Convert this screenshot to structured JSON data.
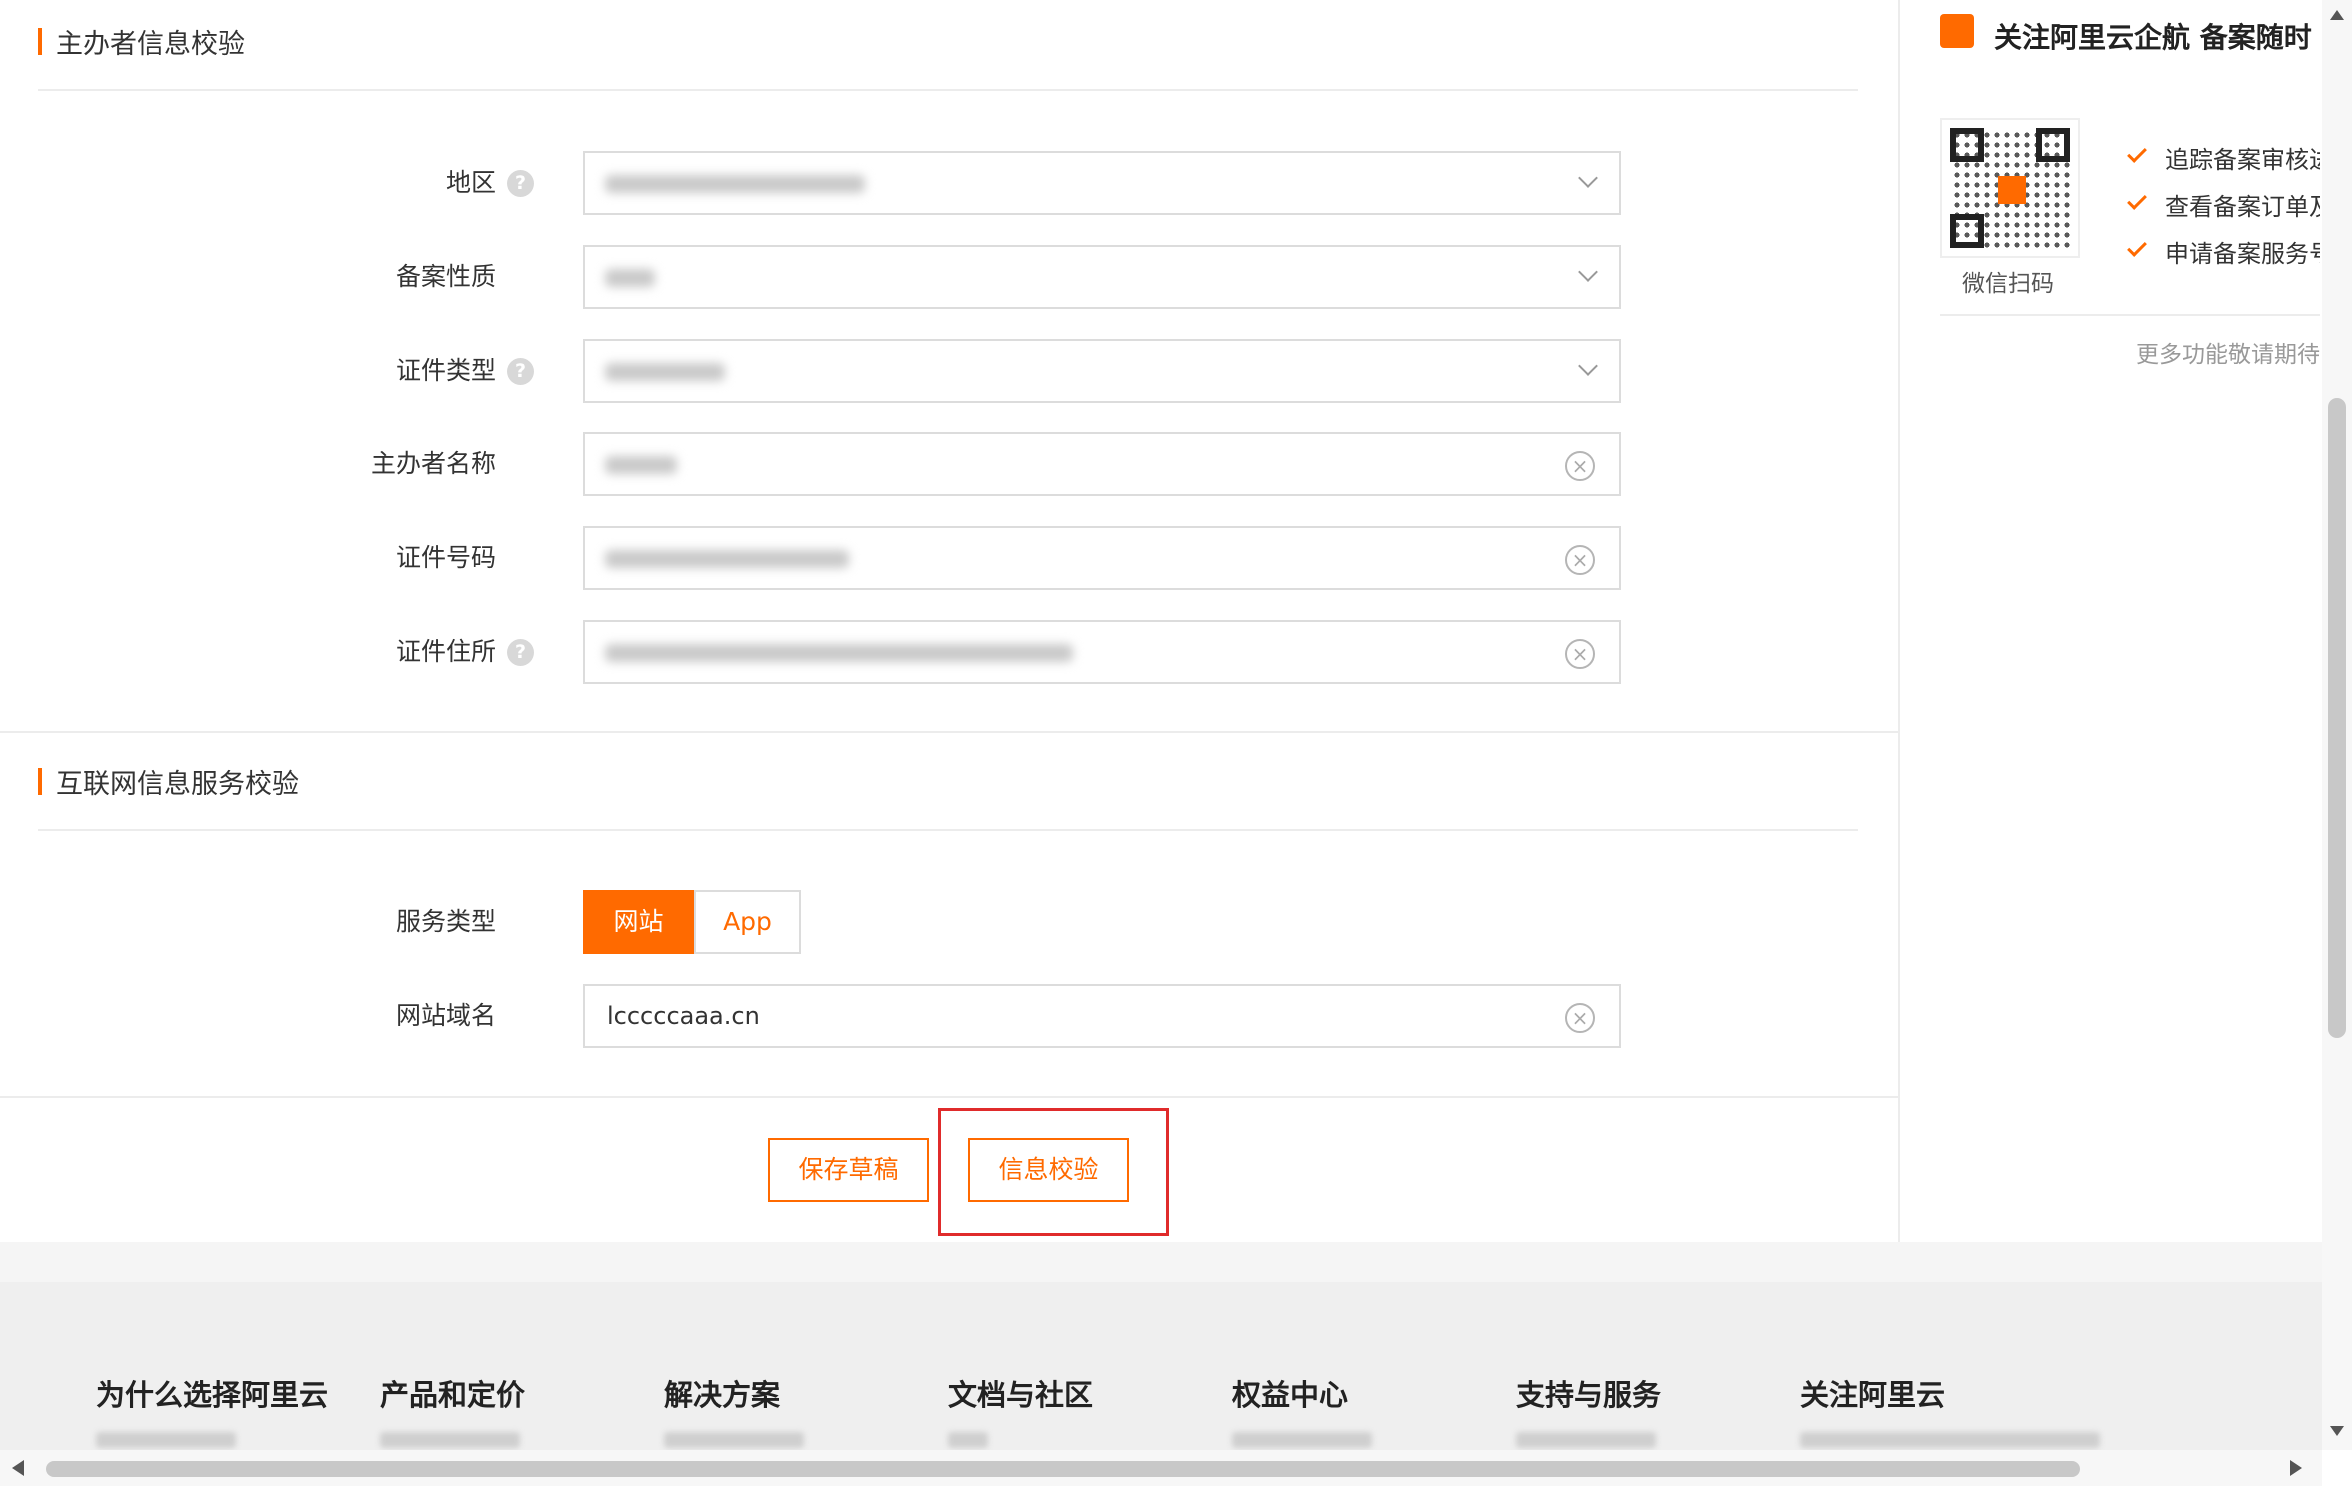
{
  "sections": {
    "sponsor_title": "主办者信息校验",
    "internet_title": "互联网信息服务校验"
  },
  "form": {
    "region_label": "地区",
    "nature_label": "备案性质",
    "cert_type_label": "证件类型",
    "sponsor_name_label": "主办者名称",
    "cert_number_label": "证件号码",
    "cert_address_label": "证件住所",
    "service_type_label": "服务类型",
    "service_type_options": [
      "网站",
      "App"
    ],
    "service_type_selected": "网站",
    "domain_label": "网站域名",
    "domain_value": "lcccccaaa.cn"
  },
  "actions": {
    "save_draft": "保存草稿",
    "verify": "信息校验"
  },
  "side_panel": {
    "title": "关注阿里云企航 备案随时",
    "qr_label": "微信扫码",
    "features": [
      "追踪备案审核进",
      "查看备案订单及",
      "申请备案服务号"
    ],
    "more": "更多功能敬请期待"
  },
  "footer": {
    "columns": [
      "为什么选择阿里云",
      "产品和定价",
      "解决方案",
      "文档与社区",
      "权益中心",
      "支持与服务",
      "关注阿里云"
    ]
  },
  "colors": {
    "accent": "#ff6a00",
    "highlight": "#e02b2b"
  },
  "icons": {
    "help": "help-circle-icon",
    "dropdown": "chevron-down-icon",
    "clear": "clear-circle-icon",
    "check": "check-icon"
  }
}
